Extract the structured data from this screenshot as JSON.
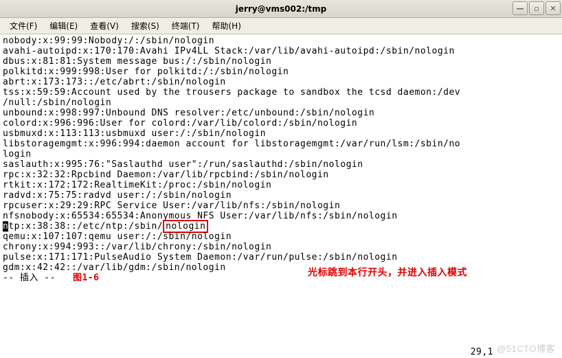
{
  "window": {
    "title": "jerry@vms002:/tmp",
    "controls": {
      "min": "—",
      "max": "▫",
      "close": "✕"
    }
  },
  "menu": {
    "file": "文件(F)",
    "edit": "编辑(E)",
    "view": "查看(V)",
    "search": "搜索(S)",
    "terminal": "终端(T)",
    "help": "帮助(H)"
  },
  "terminal": {
    "lines": [
      "nobody:x:99:99:Nobody:/:/sbin/nologin",
      "avahi-autoipd:x:170:170:Avahi IPv4LL Stack:/var/lib/avahi-autoipd:/sbin/nologin",
      "dbus:x:81:81:System message bus:/:/sbin/nologin",
      "polkitd:x:999:998:User for polkitd:/:/sbin/nologin",
      "abrt:x:173:173::/etc/abrt:/sbin/nologin",
      "tss:x:59:59:Account used by the trousers package to sandbox the tcsd daemon:/dev",
      "/null:/sbin/nologin",
      "unbound:x:998:997:Unbound DNS resolver:/etc/unbound:/sbin/nologin",
      "colord:x:996:996:User for colord:/var/lib/colord:/sbin/nologin",
      "usbmuxd:x:113:113:usbmuxd user:/:/sbin/nologin",
      "libstoragemgmt:x:996:994:daemon account for libstoragemgmt:/var/run/lsm:/sbin/no",
      "login",
      "saslauth:x:995:76:\"Saslauthd user\":/run/saslauthd:/sbin/nologin",
      "rpc:x:32:32:Rpcbind Daemon:/var/lib/rpcbind:/sbin/nologin",
      "rtkit:x:172:172:RealtimeKit:/proc:/sbin/nologin",
      "radvd:x:75:75:radvd user:/:/sbin/nologin",
      "rpcuser:x:29:29:RPC Service User:/var/lib/nfs:/sbin/nologin",
      "nfsnobody:x:65534:65534:Anonymous NFS User:/var/lib/nfs:/sbin/nologin"
    ],
    "ntp_pre": "tp:x:38:38::/etc/ntp:/sbin/",
    "ntp_highlight": "nologin",
    "ntp_cursor": "n",
    "lines_post": [
      "qemu:x:107:107:qemu user:/:/sbin/nologin",
      "chrony:x:994:993::/var/lib/chrony:/sbin/nologin",
      "pulse:x:171:171:PulseAudio System Daemon:/var/run/pulse:/sbin/nologin",
      "gdm:x:42:42::/var/lib/gdm:/sbin/nologin"
    ],
    "status": "-- 插入 --   ",
    "fig_label": "图1-6",
    "position": "29,1",
    "annotation": "光标跳到本行开头，并进入插入模式",
    "watermark": "@51CTO博客"
  }
}
